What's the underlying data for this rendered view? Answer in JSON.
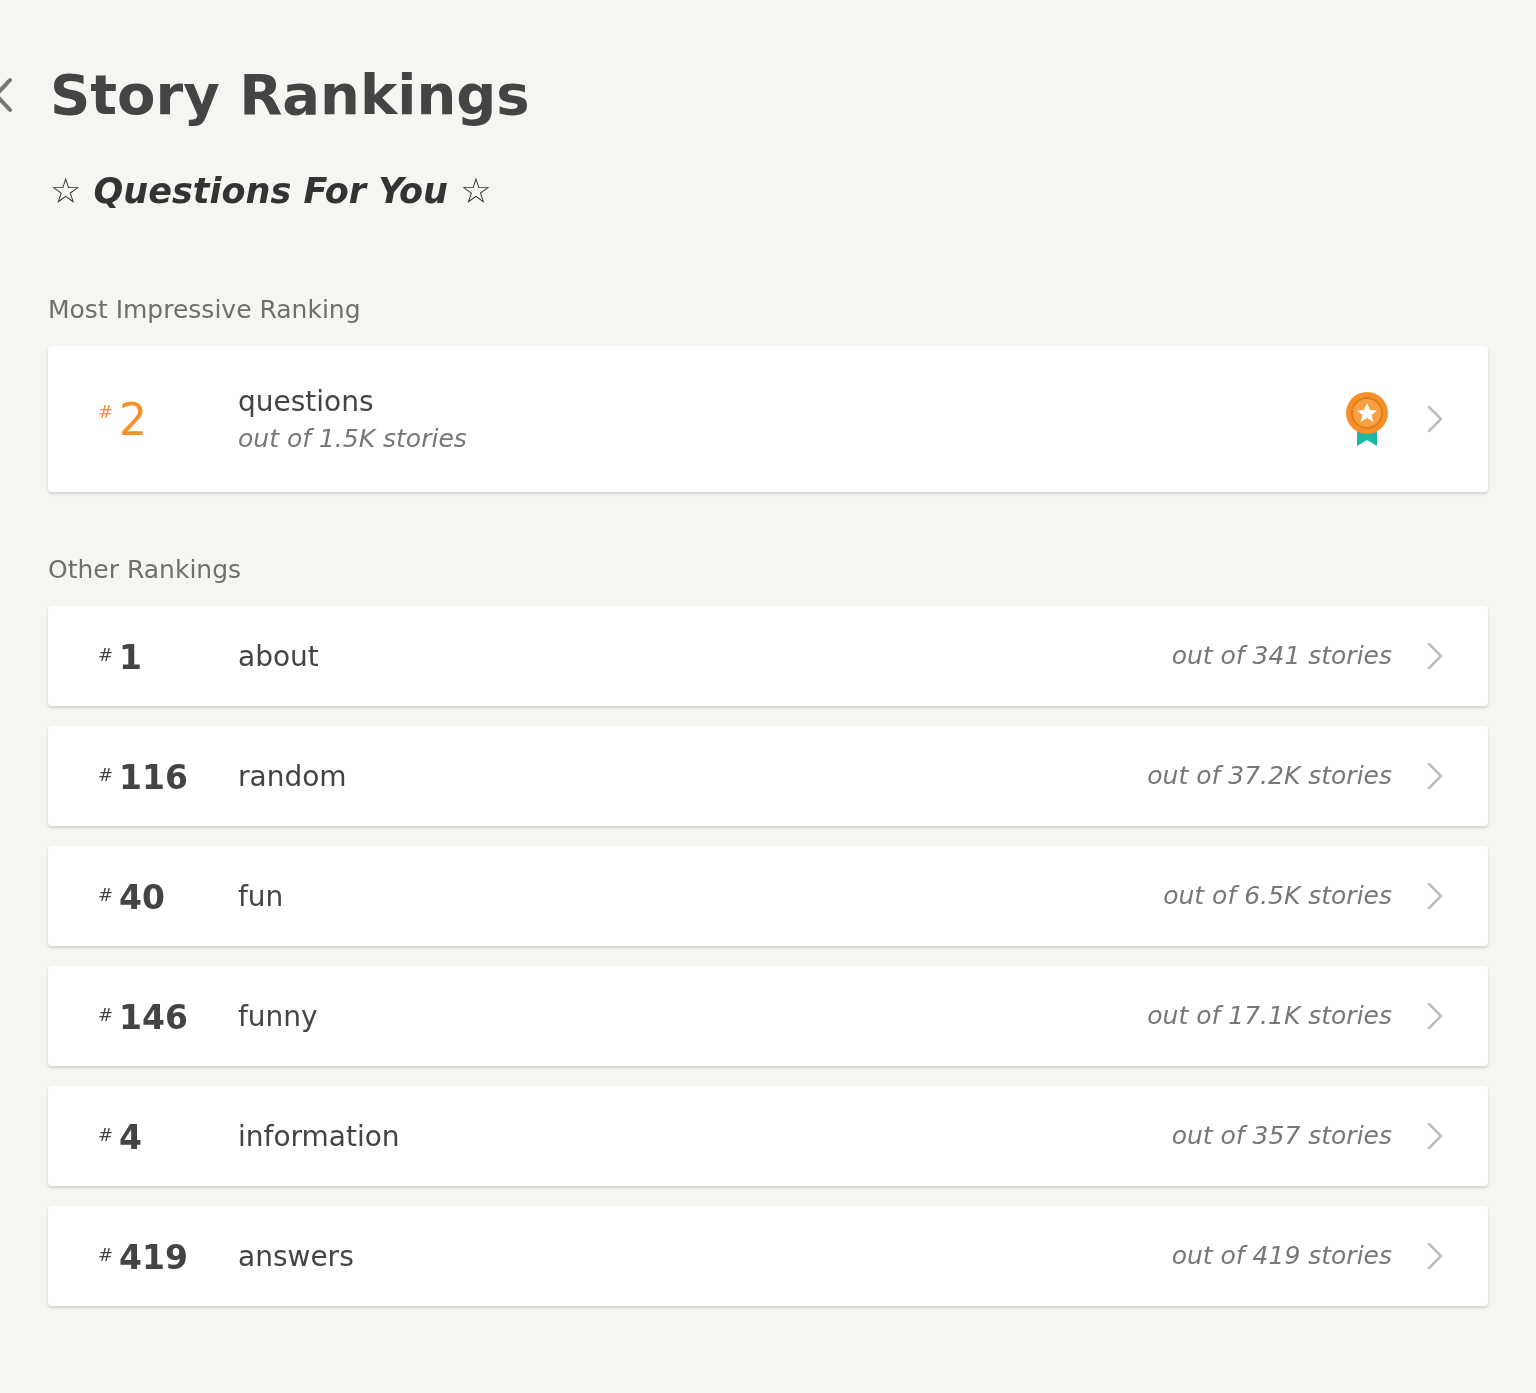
{
  "header": {
    "title": "Story Rankings"
  },
  "story_title": "☆ Questions For You ☆",
  "sections": [
    {
      "label": "Most Impressive Ranking",
      "rankings": [
        {
          "kind": "featured",
          "prefix": "#",
          "rank": "2",
          "category": "questions",
          "total": "out of 1.5K stories"
        }
      ]
    },
    {
      "label": "Other Rankings",
      "rankings": [
        {
          "kind": "regular",
          "prefix": "#",
          "rank": "1",
          "category": "about",
          "total": "out of 341 stories"
        },
        {
          "kind": "regular",
          "prefix": "#",
          "rank": "116",
          "category": "random",
          "total": "out of 37.2K stories"
        },
        {
          "kind": "regular",
          "prefix": "#",
          "rank": "40",
          "category": "fun",
          "total": "out of 6.5K stories"
        },
        {
          "kind": "regular",
          "prefix": "#",
          "rank": "146",
          "category": "funny",
          "total": "out of 17.1K stories"
        },
        {
          "kind": "regular",
          "prefix": "#",
          "rank": "4",
          "category": "information",
          "total": "out of 357 stories"
        },
        {
          "kind": "regular",
          "prefix": "#",
          "rank": "419",
          "category": "answers",
          "total": "out of 419 stories"
        }
      ]
    }
  ]
}
